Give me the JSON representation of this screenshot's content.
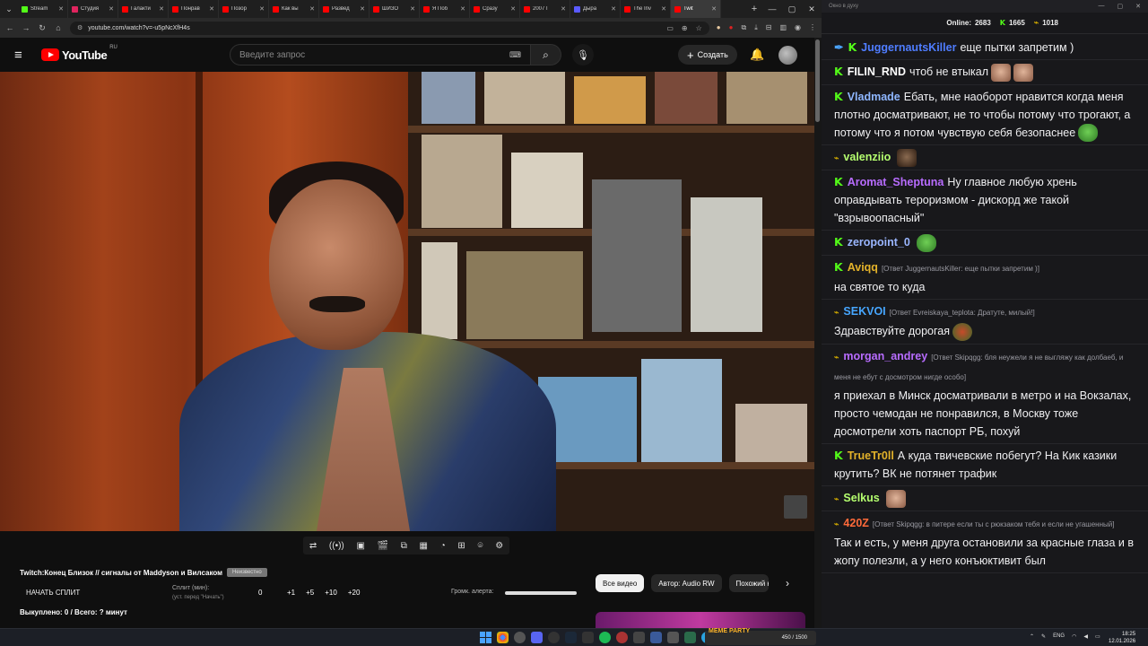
{
  "browser": {
    "tabs": [
      {
        "label": "Stream",
        "color": "#53fc18"
      },
      {
        "label": "Студия",
        "color": "#e0245e"
      },
      {
        "label": "Галакти",
        "color": "#ff0000"
      },
      {
        "label": "Понрав",
        "color": "#ff0000"
      },
      {
        "label": "Позор",
        "color": "#ff0000"
      },
      {
        "label": "Как вы",
        "color": "#ff0000"
      },
      {
        "label": "Развед",
        "color": "#ff0000"
      },
      {
        "label": "ШИЗО",
        "color": "#ff0000"
      },
      {
        "label": "Я Поб",
        "color": "#ff0000"
      },
      {
        "label": "Сразу",
        "color": "#ff0000"
      },
      {
        "label": "2007 Г",
        "color": "#ff0000"
      },
      {
        "label": "Дыра",
        "color": "#5a5aff"
      },
      {
        "label": "The Inv",
        "color": "#ff0000"
      },
      {
        "label": "Twit",
        "color": "#ff0000",
        "active": true
      }
    ],
    "url": "youtube.com/watch?v=-u5pNcXfH4s"
  },
  "youtube": {
    "region": "RU",
    "search_placeholder": "Введите запрос",
    "create_label": "Создать"
  },
  "extension": {
    "title": "Twitch:Конец Близок // сигналы от Maddyson и Вилсаком",
    "badge": "Неизвестно",
    "start_split": "НАЧАТЬ СПЛИТ",
    "split_label": "Сплит (мин):",
    "split_hint": "(уст. перед \"Начать\")",
    "split_value": "0",
    "increments": [
      "+1",
      "+5",
      "+10",
      "+20"
    ],
    "bought": "Выкуплено: 0 / Всего: ? минут",
    "alert_volume": "Громк. алерта:"
  },
  "chips": [
    "Все видео",
    "Автор: Audio RW",
    "Похожий к"
  ],
  "chat": {
    "window_title": "Окно в духу",
    "online_label": "Online:",
    "online_count": "2683",
    "kick_count": "1665",
    "horn_count": "1018",
    "messages": [
      {
        "badge": "sword+k",
        "user": "JuggernautsKiller",
        "color": "#4f7dff",
        "text": "еще пытки запретим )"
      },
      {
        "badge": "k",
        "user": "FILIN_RND",
        "color": "#ffffff",
        "text": "чтоб не втыкал",
        "emotes": [
          "face",
          "face"
        ]
      },
      {
        "badge": "k",
        "user": "Vladmade",
        "color": "#8fb7ff",
        "text": "Ебать, мне наоборот нравится когда меня плотно досматривают, не то чтобы потому что трогают, а потому что я потом чувствую себя безопаснее",
        "emotes": [
          "pepe"
        ]
      },
      {
        "badge": "horn",
        "user": "valenziio",
        "color": "#b5ff6f",
        "text": "",
        "emotes": [
          "dark"
        ]
      },
      {
        "badge": "k",
        "user": "Aromat_Sheptuna",
        "color": "#b86cff",
        "text": "Ну главное любую хрень оправдывать тероризмом - дискорд же такой \"взрывоопасный\""
      },
      {
        "badge": "k",
        "user": "zeropoint_0",
        "color": "#9ab6ff",
        "text": "",
        "emotes": [
          "pepe"
        ]
      },
      {
        "badge": "k",
        "user": "Aviqq",
        "color": "#e3b22a",
        "reply": "[Ответ JuggernautsKiller: еще пытки запретим )]",
        "text": "на святое то куда"
      },
      {
        "badge": "horn",
        "user": "SEKVOI",
        "color": "#46a6ff",
        "reply": "[Ответ Evreiskaya_teplota: Дратуте, милый!]",
        "text": "Здравствуйте дорогая",
        "emotes": [
          "red"
        ]
      },
      {
        "badge": "horn",
        "user": "morgan_andrey",
        "color": "#b86cff",
        "reply": "[Ответ Skipqgg: бля неужели я не выгляжу как долбаеб, и меня не ебут с досмотром нигде особо]",
        "text": "я приехал в Минск досматривали в метро и на Вокзалах, просто чемодан не понравился, в Москву тоже досмотрели хоть паспорт РБ, похуй"
      },
      {
        "badge": "k",
        "user": "TrueTr0ll",
        "color": "#e3b22a",
        "text": "А куда твичевские побегут? На Кик казики крутить? ВК не потянет трафик"
      },
      {
        "badge": "horn",
        "user": "Selkus",
        "color": "#b5ff6f",
        "text": "",
        "emotes": [
          "face"
        ]
      },
      {
        "badge": "horn",
        "user": "420Z",
        "color": "#ff6a3a",
        "reply": "[Ответ Skipqgg: в питере если ты с рюкзаком тебя и если не угашенный]",
        "text": "Так и есть, у меня друга остановили за красные глаза и в жопу полезли, а у него конъюктивит был"
      }
    ]
  },
  "taskbar": {
    "game_text": "450 / 1500",
    "game_logo": "MEME PARTY",
    "lang": "ENG",
    "time": "18:25",
    "date": "12.01.2026"
  }
}
